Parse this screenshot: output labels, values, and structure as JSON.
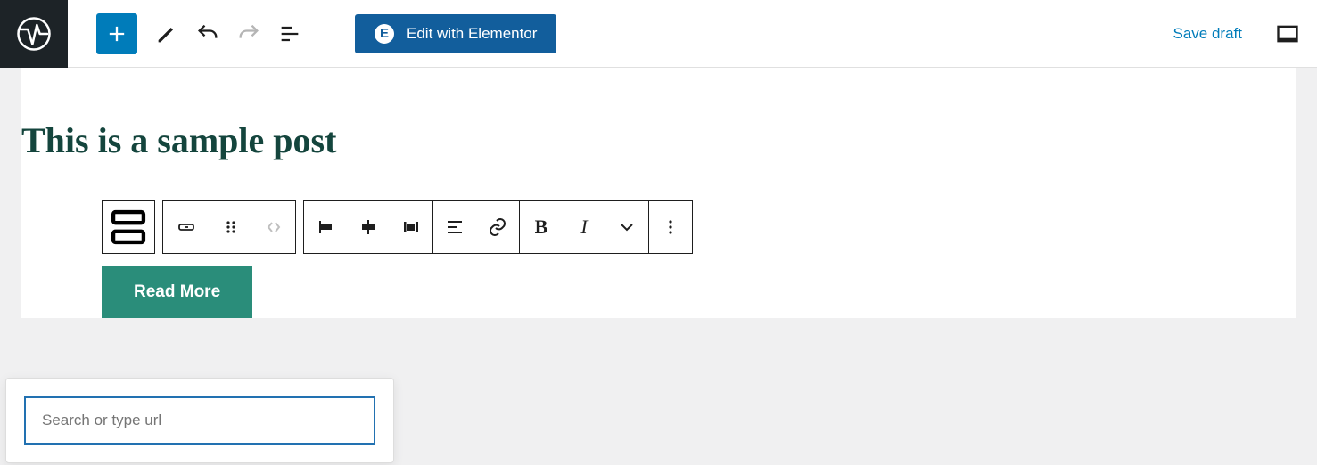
{
  "header": {
    "elementor_label": "Edit with Elementor",
    "save_draft": "Save draft"
  },
  "post": {
    "title": "This is a sample post",
    "button_label": "Read More"
  },
  "link_popover": {
    "placeholder": "Search or type url"
  }
}
